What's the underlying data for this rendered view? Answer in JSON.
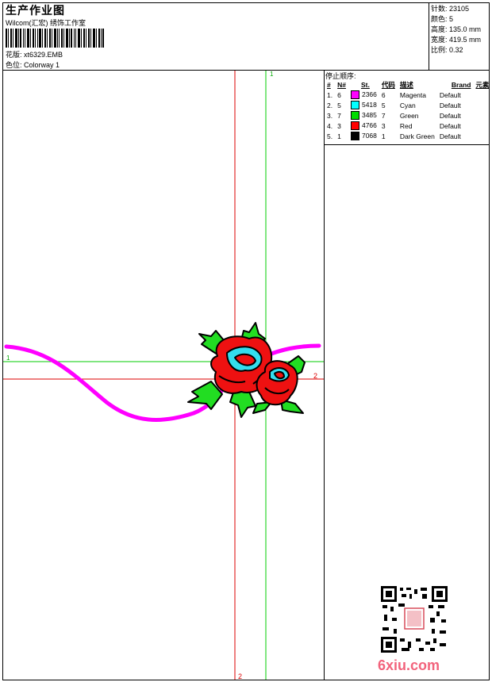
{
  "header": {
    "title": "生产作业图",
    "company": "Wilcom(汇宏) 绣饰工作室",
    "design": "花版: xt6329.EMB",
    "colorway": "色位: Colorway 1"
  },
  "stats": [
    "针数: 23105",
    "颜色: 5",
    "高度: 135.0 mm",
    "宽度: 419.5 mm",
    "比例: 0.32"
  ],
  "stop_sequence": {
    "label": "停止顺序:",
    "headers": [
      "#",
      "N#",
      "St.",
      "代码",
      "描述",
      "Brand",
      "元素"
    ],
    "rows": [
      {
        "idx": "1.",
        "n": "6",
        "st": "2366",
        "code": "6",
        "desc": "Magenta",
        "brand": "Default",
        "color": "#ff00ff"
      },
      {
        "idx": "2.",
        "n": "5",
        "st": "5418",
        "code": "5",
        "desc": "Cyan",
        "brand": "Default",
        "color": "#00ffff"
      },
      {
        "idx": "3.",
        "n": "7",
        "st": "3485",
        "code": "7",
        "desc": "Green",
        "brand": "Default",
        "color": "#00dd00"
      },
      {
        "idx": "4.",
        "n": "3",
        "st": "4766",
        "code": "3",
        "desc": "Red",
        "brand": "Default",
        "color": "#ff0000"
      },
      {
        "idx": "5.",
        "n": "1",
        "st": "7068",
        "code": "1",
        "desc": "Dark Green",
        "brand": "Default",
        "color": "#000000"
      }
    ]
  },
  "guides": {
    "green_vertical": "1",
    "green_horizontal": "1",
    "red_horizontal": "2",
    "red_vertical": "2"
  },
  "watermark": "6xiu.com",
  "colors": {
    "magenta": "#ff00ff",
    "cyan": "#00ffff",
    "green": "#00dd00",
    "red": "#ff0000",
    "guide_green": "#00cc00",
    "guide_red": "#dd0000"
  }
}
